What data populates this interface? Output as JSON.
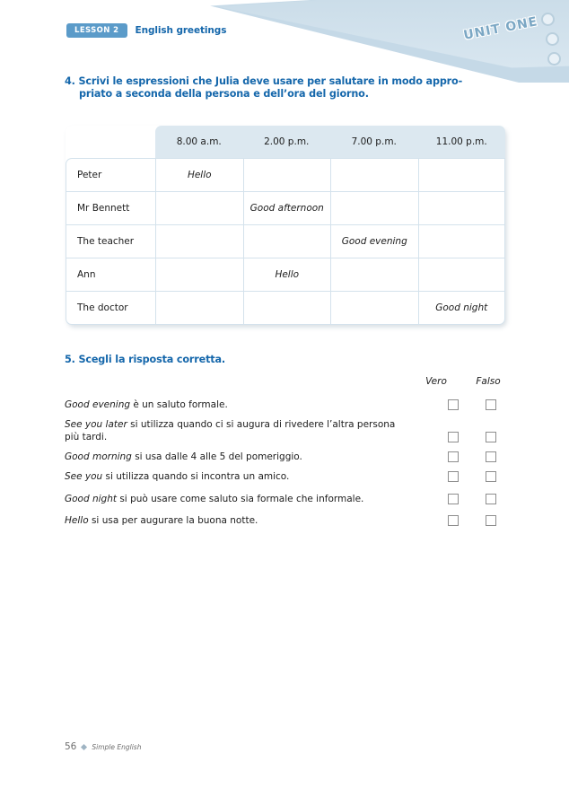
{
  "banner": {
    "unit_label": "UNIT ONE"
  },
  "lesson_header": {
    "badge": "LESSON 2",
    "title": "English greetings"
  },
  "exercise4": {
    "number": "4.",
    "line1": "Scrivi le espressioni che Julia deve usare per salutare in modo appro-",
    "line2": "priato a seconda della persona e dell’ora del giorno.",
    "table": {
      "corner_header": "",
      "column_headers": [
        "8.00 a.m.",
        "2.00 p.m.",
        "7.00 p.m.",
        "11.00 p.m."
      ],
      "rows": [
        {
          "name": "Peter",
          "answers": [
            "Hello",
            "",
            "",
            ""
          ]
        },
        {
          "name": "Mr Bennett",
          "answers": [
            "",
            "Good afternoon",
            "",
            ""
          ]
        },
        {
          "name": "The teacher",
          "answers": [
            "",
            "",
            "Good evening",
            ""
          ]
        },
        {
          "name": "Ann",
          "answers": [
            "",
            "Hello",
            "",
            ""
          ]
        },
        {
          "name": "The doctor",
          "answers": [
            "",
            "",
            "",
            "Good night"
          ]
        }
      ]
    }
  },
  "exercise5": {
    "number": "5.",
    "heading": "Scegli la risposta corretta.",
    "col_vero": "Vero",
    "col_falso": "Falso",
    "statements": [
      {
        "english": "Good evening",
        "italian": " è un saluto formale."
      },
      {
        "english": "See you later",
        "italian": " si utilizza quando ci si augura di rivedere l’altra persona più tardi."
      },
      {
        "english": "Good morning",
        "italian": " si usa dalle 4 alle 5 del pomeriggio."
      },
      {
        "english": "See you",
        "italian": " si utilizza quando si incontra un amico."
      },
      {
        "english": "Good night",
        "italian": " si può usare come saluto sia formale che informale."
      },
      {
        "english": "Hello",
        "italian": " si usa per augurare la buona notte."
      }
    ]
  },
  "footer": {
    "page_number": "56",
    "book_title": "Simple English"
  },
  "colors": {
    "heading_blue": "#1567ab",
    "badge_blue": "#5b9bc9",
    "banner_blue": "#c5d9e7",
    "table_header": "#dce8f0",
    "table_border": "#d4e2ec"
  }
}
